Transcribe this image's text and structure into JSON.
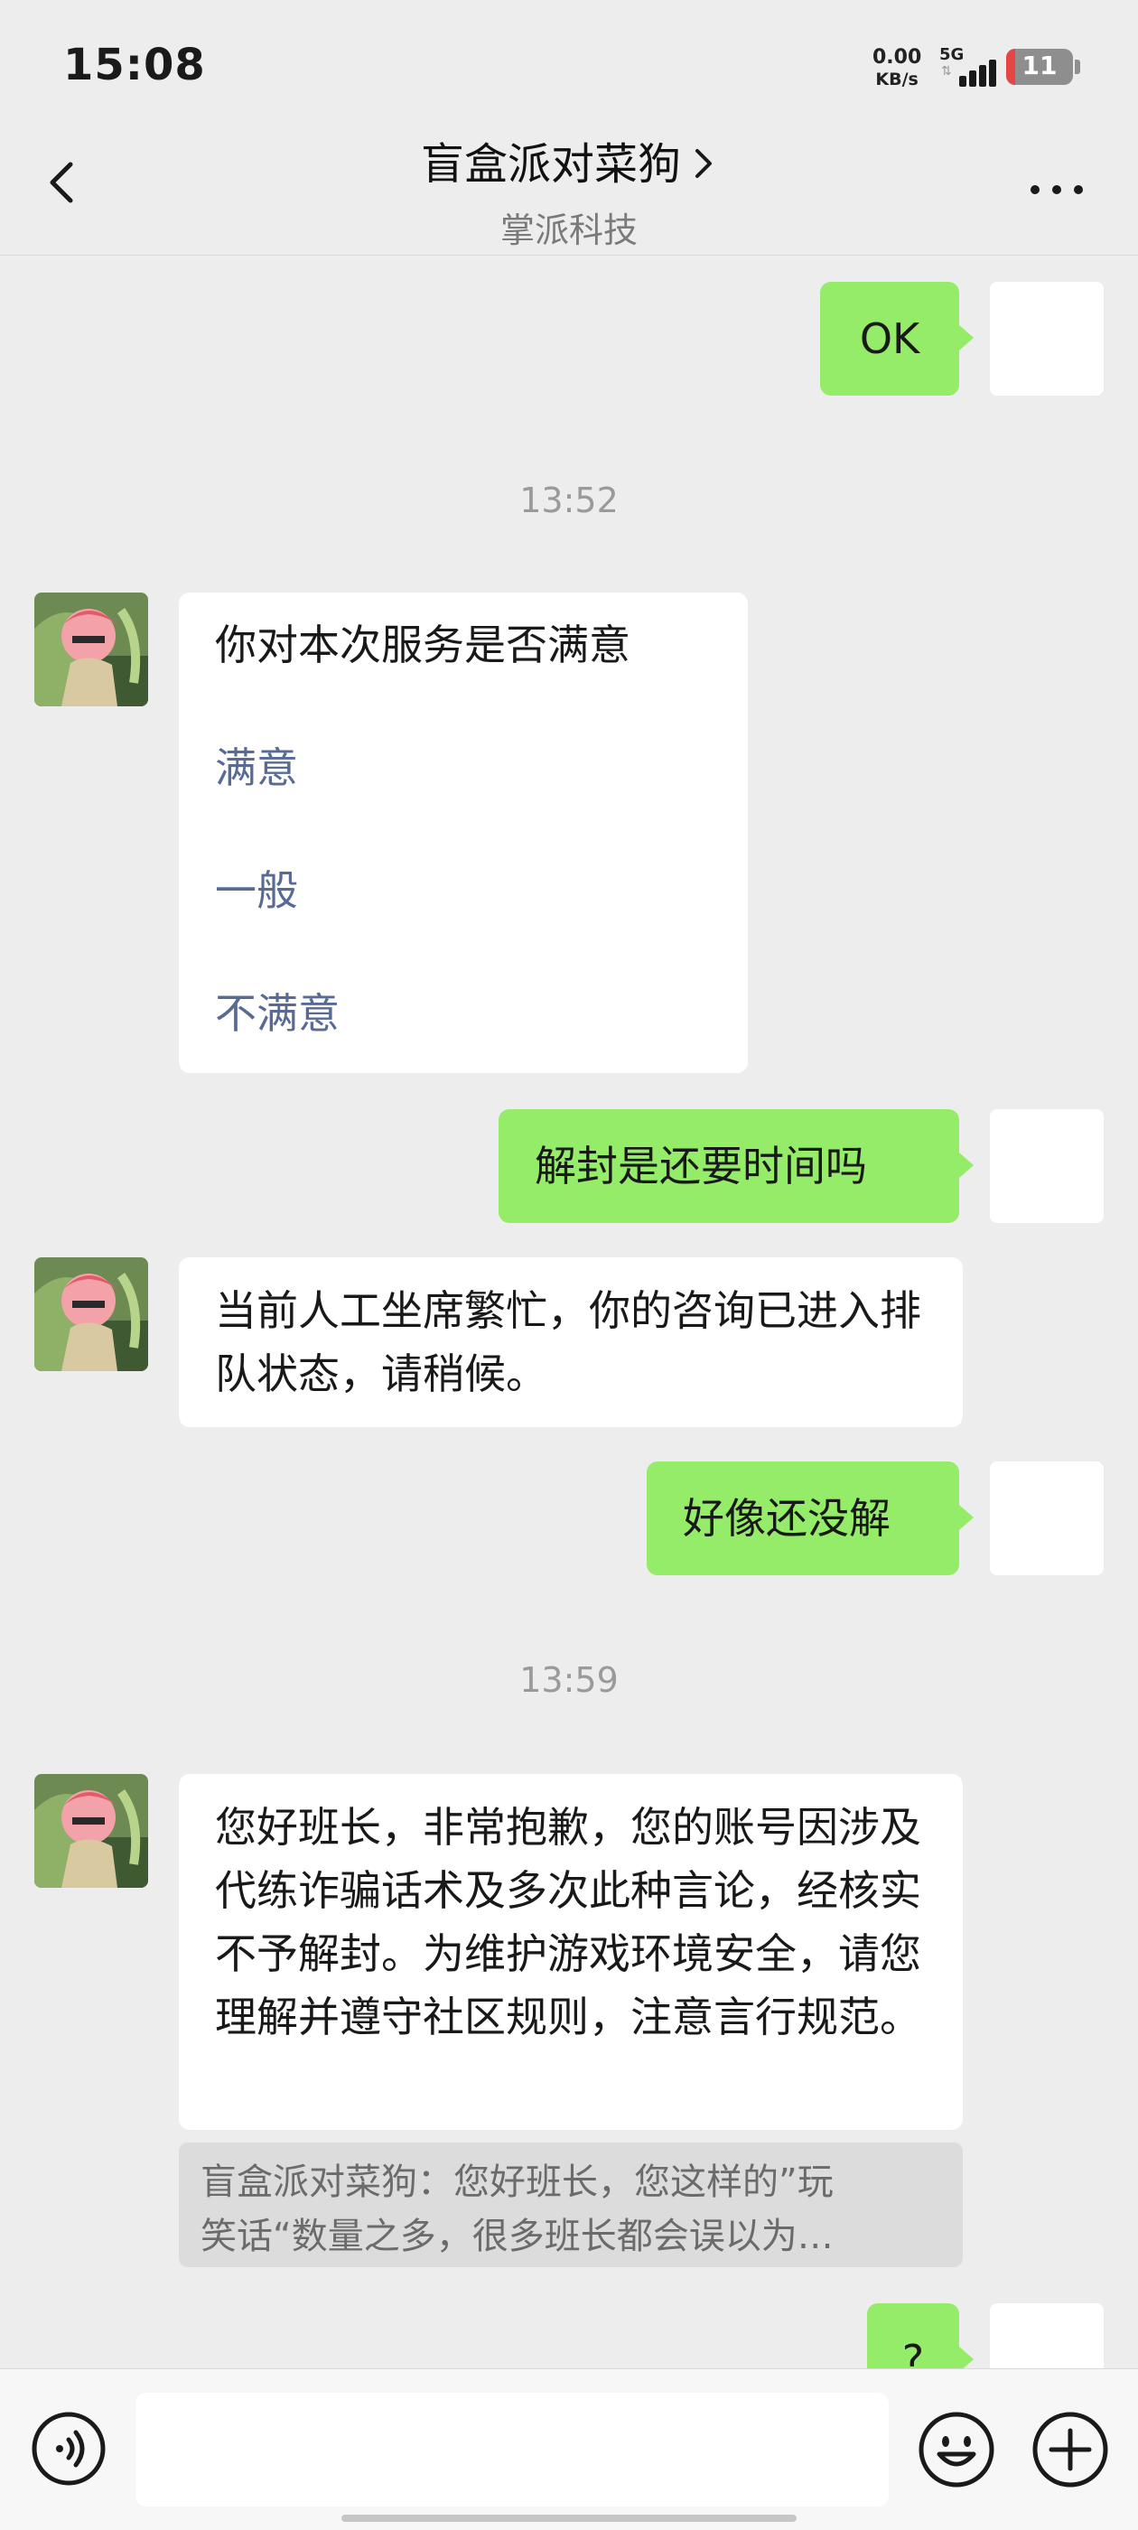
{
  "status_bar": {
    "time": "15:08",
    "net_speed": "0.00",
    "net_unit": "KB/s",
    "network": "5G",
    "battery_level": "11",
    "battery_fraction": 0.11
  },
  "header": {
    "title": "盲盒派对菜狗",
    "subtitle": "掌派科技"
  },
  "messages": {
    "m1": "OK",
    "ts1": "13:52",
    "survey": {
      "question": "你对本次服务是否满意",
      "options": [
        "满意",
        "一般",
        "不满意"
      ]
    },
    "m3": "解封是还要时间吗",
    "m4": "当前人工坐席繁忙，你的咨询已进入排队状态，请稍候。",
    "m5": "好像还没解",
    "ts2": "13:59",
    "m6": "您好班长，非常抱歉，您的账号因涉及代练诈骗话术及多次此种言论，经核实不予解封。为维护游戏环境安全，请您理解并遵守社区规则，注意言行规范。",
    "quote_line1": "盲盒派对菜狗：您好班长，您这样的”玩",
    "quote_line2": "笑话“数量之多，很多班长都会误以为…",
    "m7": "?"
  },
  "colors": {
    "my_bubble": "#95ec69",
    "other_bubble": "#ffffff",
    "link": "#576b95",
    "background": "#ededed"
  },
  "icons": {
    "back": "chevron-left-icon",
    "more": "more-dots-icon",
    "voice": "voice-icon",
    "emoji": "emoji-icon",
    "plus": "plus-icon"
  }
}
